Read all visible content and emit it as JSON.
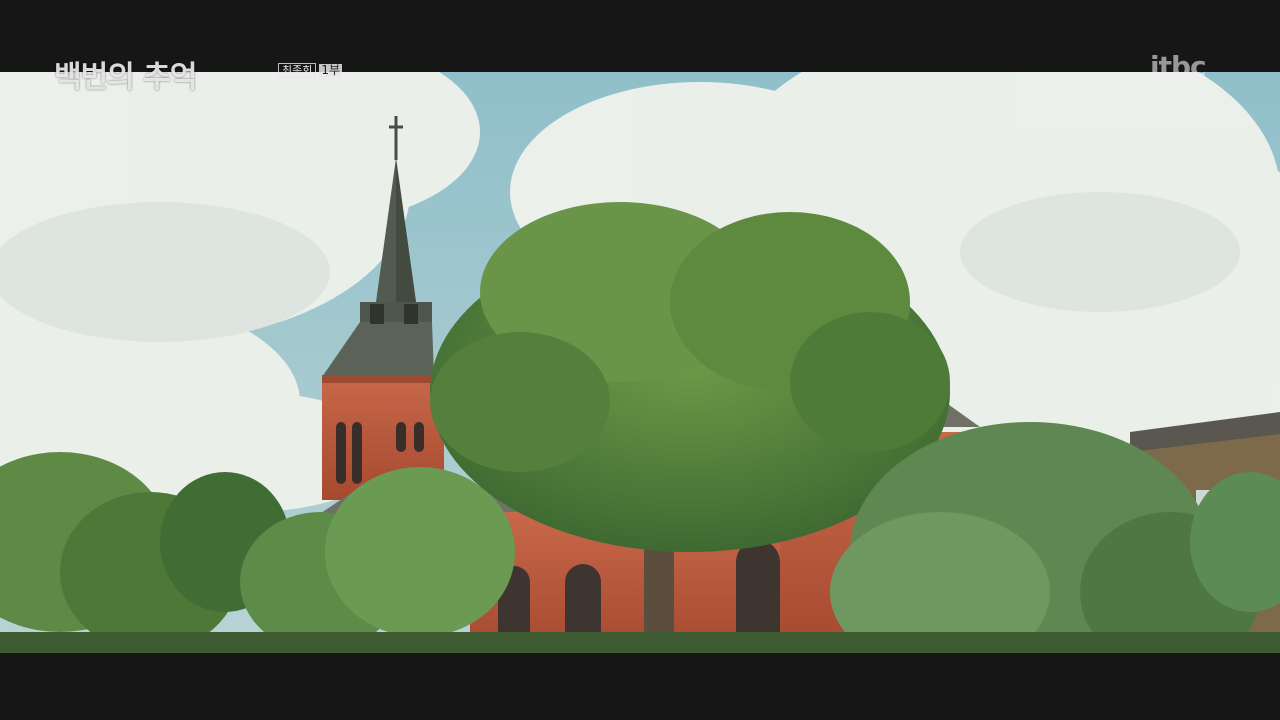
{
  "overlay": {
    "program_title": "백번의 추억",
    "episode_name": "최종회",
    "episode_suffix": "1부",
    "channel_logo": "jtbc"
  },
  "scene": {
    "description_colors": {
      "sky": "#9ec6cf",
      "cloud": "#f1f3ef",
      "brick": "#b85a3c",
      "spire": "#50584e",
      "foliage": "#4f7a3a",
      "letterbox": "#161616"
    }
  }
}
